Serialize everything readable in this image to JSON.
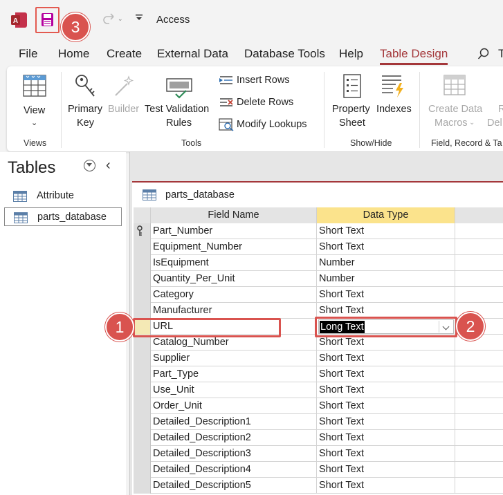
{
  "title_bar": {
    "app_title": "Access",
    "save_badge": "3"
  },
  "menu": {
    "tabs": [
      "File",
      "Home",
      "Create",
      "External Data",
      "Database Tools",
      "Help",
      "Table Design"
    ],
    "active_tab": "Table Design",
    "truncated": "T"
  },
  "ribbon": {
    "view_label": "View",
    "views_group": "Views",
    "primary_key_1": "Primary",
    "primary_key_2": "Key",
    "builder": "Builder",
    "test_validation_1": "Test Validation",
    "test_validation_2": "Rules",
    "insert_rows": "Insert Rows",
    "delete_rows": "Delete Rows",
    "modify_lookups": "Modify Lookups",
    "tools_group": "Tools",
    "property_sheet_1": "Property",
    "property_sheet_2": "Sheet",
    "indexes": "Indexes",
    "show_hide_group": "Show/Hide",
    "create_data_macros_1": "Create Data",
    "create_data_macros_2": "Macros",
    "rename_partial_1": "R",
    "rename_partial_2": "Del",
    "field_record_group": "Field, Record & Ta"
  },
  "nav": {
    "title": "Tables",
    "items": [
      {
        "label": "Attribute",
        "selected": false
      },
      {
        "label": "parts_database",
        "selected": true
      }
    ]
  },
  "document": {
    "tab_label": "parts_database",
    "columns": {
      "field_name": "Field Name",
      "data_type": "Data Type"
    },
    "rows": [
      {
        "field": "Part_Number",
        "type": "Short Text",
        "primary_key": true
      },
      {
        "field": "Equipment_Number",
        "type": "Short Text"
      },
      {
        "field": "IsEquipment",
        "type": "Number"
      },
      {
        "field": "Quantity_Per_Unit",
        "type": "Number"
      },
      {
        "field": "Category",
        "type": "Short Text"
      },
      {
        "field": "Manufacturer",
        "type": "Short Text"
      },
      {
        "field": "URL",
        "type": "Long Text",
        "current": true
      },
      {
        "field": "Catalog_Number",
        "type": "Short Text"
      },
      {
        "field": "Supplier",
        "type": "Short Text"
      },
      {
        "field": "Part_Type",
        "type": "Short Text"
      },
      {
        "field": "Use_Unit",
        "type": "Short Text"
      },
      {
        "field": "Order_Unit",
        "type": "Short Text"
      },
      {
        "field": "Detailed_Description1",
        "type": "Short Text"
      },
      {
        "field": "Detailed_Description2",
        "type": "Short Text"
      },
      {
        "field": "Detailed_Description3",
        "type": "Short Text"
      },
      {
        "field": "Detailed_Description4",
        "type": "Short Text"
      },
      {
        "field": "Detailed_Description5",
        "type": "Short Text"
      }
    ]
  },
  "annotations": {
    "badge_1": "1",
    "badge_2": "2",
    "badge_3": "3",
    "accent_color": "#d9534f"
  }
}
